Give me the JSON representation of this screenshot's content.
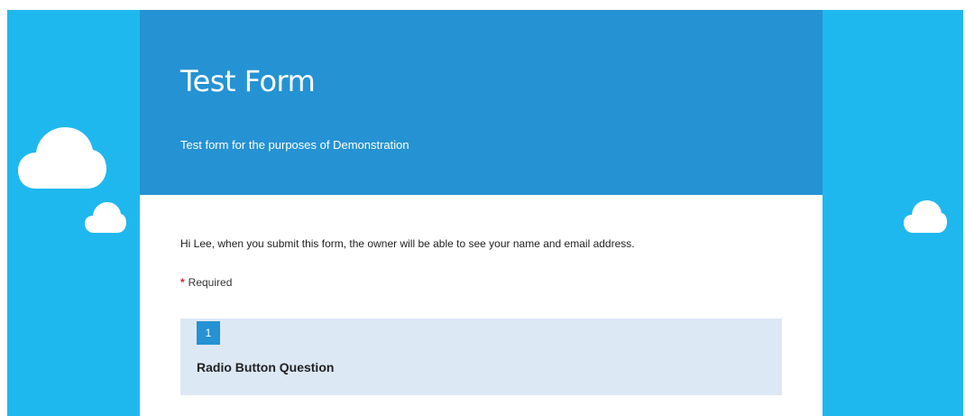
{
  "header": {
    "title": "Test Form",
    "subtitle": "Test form for the purposes of Demonstration"
  },
  "intro": {
    "text": "Hi Lee, when you submit this form, the owner will be able to see your name and email address."
  },
  "required": {
    "star": "*",
    "label": "Required"
  },
  "question": {
    "number": "1",
    "title": "Radio Button Question"
  },
  "colors": {
    "backdrop": "#1fb8ee",
    "header": "#2592d3",
    "question_bg": "#dce8f4",
    "required_star": "#e02020"
  }
}
